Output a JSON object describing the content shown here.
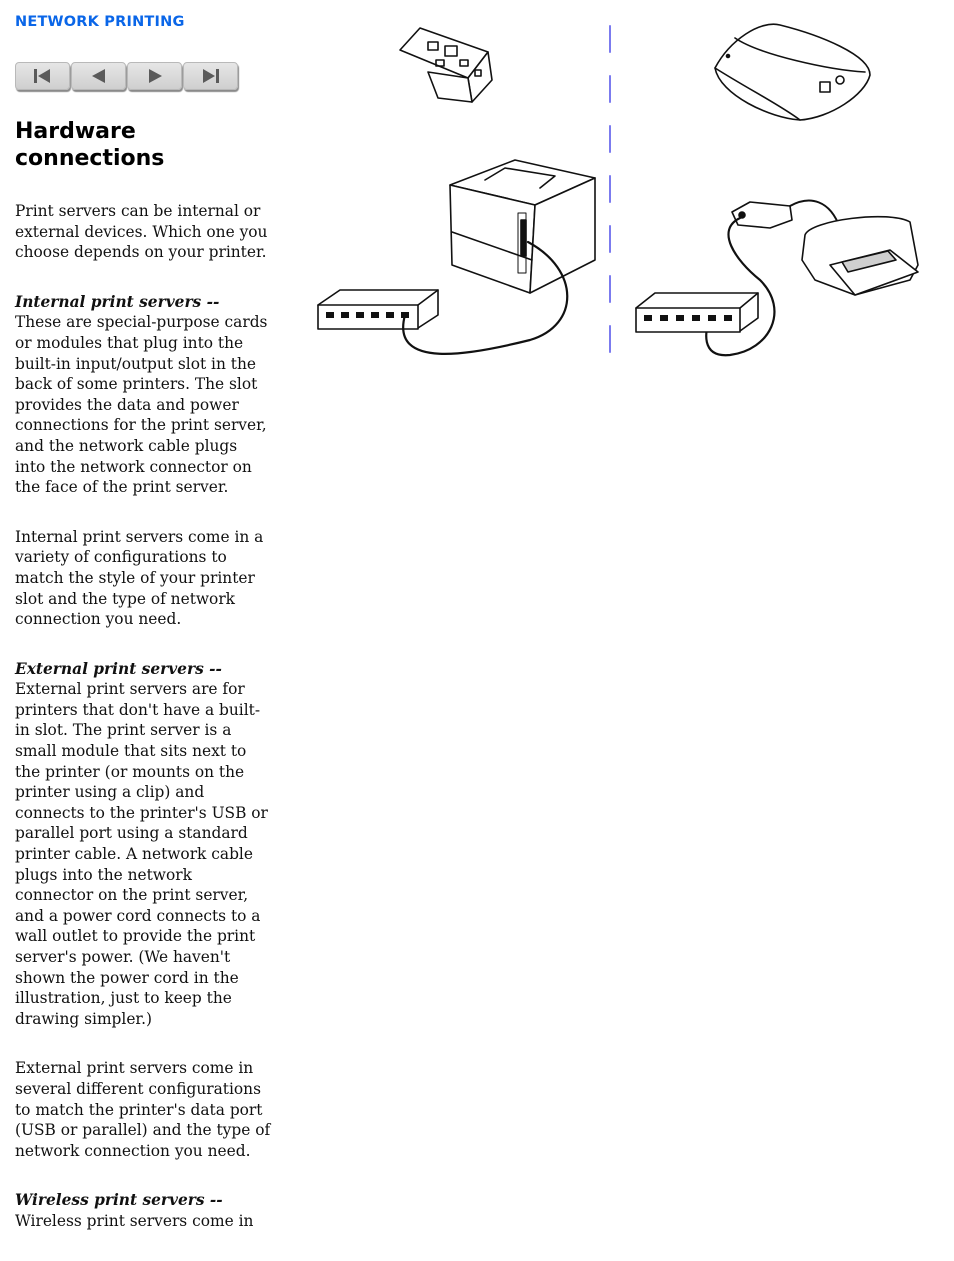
{
  "header": {
    "section": "NETWORK PRINTING",
    "section_color": "#0a66e8"
  },
  "nav": {
    "buttons": [
      {
        "label": "first-page",
        "icon": "first-icon"
      },
      {
        "label": "previous-page",
        "icon": "previous-icon"
      },
      {
        "label": "next-page",
        "icon": "next-icon"
      },
      {
        "label": "last-page",
        "icon": "last-icon"
      }
    ]
  },
  "page": {
    "title": "Hardware connections",
    "intro": "Print servers can be internal or external devices. Which one you choose depends on your printer.",
    "sections": [
      {
        "term": "Internal print servers --",
        "text": "These are special-purpose cards or modules that plug into the built-in input/output slot in the back of some printers. The slot provides the data and power connections for the print server, and the network cable plugs into the network connector on the face of the print server."
      },
      {
        "term": "",
        "text": "Internal print servers come in a variety of configurations to match the style of your printer slot and the type of network connection you need."
      },
      {
        "term": "External print servers --",
        "text": "External print servers are for printers that don't have a built-in slot. The print server is a small module that sits next to the printer (or mounts on the printer using a clip) and connects to the printer's USB or parallel port using a standard printer cable. A network cable plugs into the network connector on the print server, and a power cord connects to a wall outlet to provide the print server's power. (We haven't shown the power cord in the illustration, just to keep the drawing simpler.)"
      },
      {
        "term": "",
        "text": "External print servers come in several different configurations to match the printer's data port (USB or parallel) and the type of network connection you need."
      },
      {
        "term": "Wireless print servers --",
        "text": "Wireless print servers come in"
      }
    ]
  },
  "illustration": {
    "left_panel": [
      "internal-print-server-card",
      "laser-printer",
      "network-hub"
    ],
    "right_panel": [
      "external-print-server-box",
      "external-print-server-module",
      "inkjet-printer",
      "network-hub"
    ],
    "divider_color": "#7b7bef"
  }
}
